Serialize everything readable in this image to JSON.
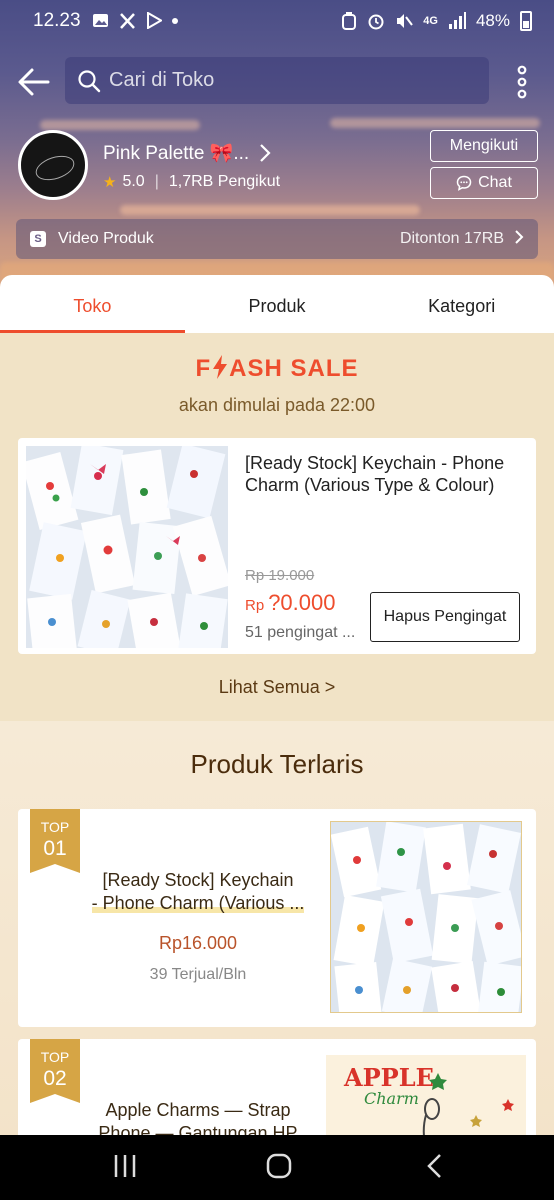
{
  "status_bar": {
    "time": "12.23",
    "network": "4G",
    "battery": "48%",
    "icons": [
      "gallery-icon",
      "x-icon",
      "play-store-icon",
      "dot-icon",
      "battery-saver-icon",
      "alarm-icon",
      "mute-icon",
      "network-icon",
      "signal-icon",
      "battery-icon"
    ]
  },
  "header": {
    "search_placeholder": "Cari di Toko",
    "icons": [
      "back-arrow-icon",
      "search-icon",
      "more-vertical-icon"
    ]
  },
  "shop": {
    "name": "Pink Palette 🎀...",
    "rating": "5.0",
    "followers": "1,7RB Pengikut",
    "follow_label": "Mengikuti",
    "chat_label": "Chat"
  },
  "video_bar": {
    "label": "Video Produk",
    "views": "Ditonton 17RB"
  },
  "tabs": [
    {
      "label": "Toko",
      "active": true
    },
    {
      "label": "Produk",
      "active": false
    },
    {
      "label": "Kategori",
      "active": false
    }
  ],
  "flash_sale": {
    "title_f": "F",
    "title_rest_1": "ASH",
    "title_rest_2": "SALE",
    "subtitle": "akan dimulai pada 22:00",
    "product": {
      "name": "[Ready Stock] Keychain - Phone Charm (Various Type & Colour)",
      "old_price": "Rp 19.000",
      "currency": "Rp",
      "price": "?0.000",
      "reminders": "51 pengingat ...",
      "button": "Hapus Pengingat"
    },
    "see_all": "Lihat Semua >"
  },
  "best_sellers": {
    "title": "Produk Terlaris",
    "items": [
      {
        "badge_top": "TOP",
        "badge_rank": "01",
        "name_line1": "[Ready Stock] Keychain",
        "name_line2": "- Phone Charm (Various ...",
        "price": "Rp16.000",
        "sold": "39 Terjual/Bln"
      },
      {
        "badge_top": "TOP",
        "badge_rank": "02",
        "name_line1": "Apple Charms — Strap",
        "name_line2": "Phone — Gantungan HP",
        "image_text_1": "APPLE",
        "image_text_2": "Charm"
      }
    ]
  },
  "colors": {
    "accent": "#ee4d2d",
    "gold_badge": "#d6a545",
    "page_bg": "#f1e3c6"
  }
}
